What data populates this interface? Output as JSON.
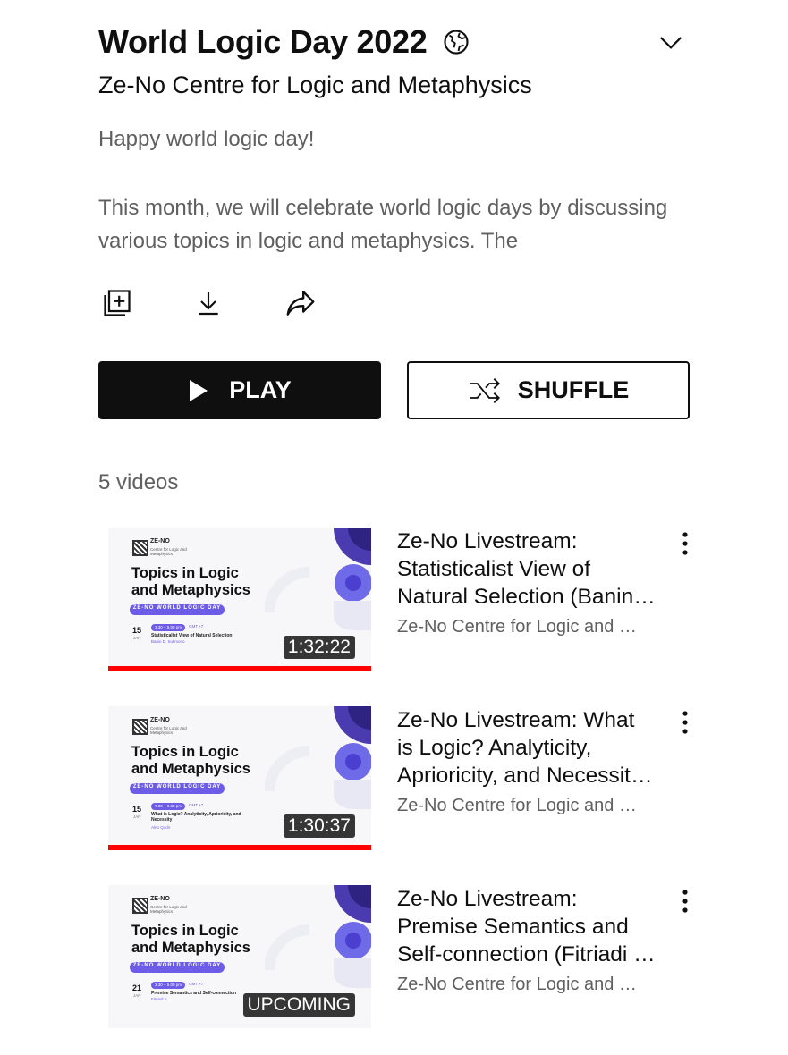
{
  "playlist": {
    "title": "World Logic Day 2022",
    "channel": "Ze-No Centre for Logic and Metaphysics",
    "description_line1": "Happy world logic day!",
    "description_line2": "This month, we will celebrate world logic days by discussing various topics in logic and metaphysics. The",
    "visibility_icon": "globe-icon",
    "expand_icon": "chevron-down-icon"
  },
  "actions": {
    "save_icon": "add-to-library-icon",
    "download_icon": "download-icon",
    "share_icon": "share-icon"
  },
  "buttons": {
    "play_label": "PLAY",
    "shuffle_label": "SHUFFLE"
  },
  "video_count": "5 videos",
  "thumbnail_common": {
    "brand": "ZE-NO",
    "brand_sub": "Centre for Logic and Metaphysics",
    "headline_1": "Topics in Logic",
    "headline_2": "and Metaphysics",
    "pill": "ZE-NO  WORLD LOGIC DAY",
    "month": "JAN",
    "gmt": "GMT +7"
  },
  "videos": [
    {
      "title_line1": "Ze-No Livestream:",
      "title_line2": "Statisticalist View of",
      "title_line3": "Natural Selection (Banin…",
      "channel": "Ze-No Centre for Logic and …",
      "duration": "1:32:22",
      "watched_fraction": 1.0,
      "thumb_day": "15",
      "thumb_time": "3.30 – 5.00 pm",
      "thumb_talk": "Statisticalist View of Natural Selection",
      "thumb_speaker": "Banin D. Sukmono"
    },
    {
      "title_line1": "Ze-No Livestream: What",
      "title_line2": "is Logic? Analyticity,",
      "title_line3": "Aprioricity, and Necessit…",
      "channel": "Ze-No Centre for Logic and …",
      "duration": "1:30:37",
      "watched_fraction": 1.0,
      "thumb_day": "15",
      "thumb_time": "7.00 – 8.30 pm",
      "thumb_talk": "What is Logic? Analyticity, Aprioricity, and Necessity",
      "thumb_speaker": "Alno Qodir"
    },
    {
      "title_line1": "Ze-No Livestream:",
      "title_line2": "Premise Semantics and",
      "title_line3": "Self-connection (Fitriadi …",
      "channel": "Ze-No Centre for Logic and …",
      "duration": "UPCOMING",
      "thumb_day": "21",
      "thumb_time": "3.30 – 5.00 pm",
      "thumb_talk": "Premise Semantics and Self-connection",
      "thumb_speaker": "Fitriadi K."
    }
  ]
}
